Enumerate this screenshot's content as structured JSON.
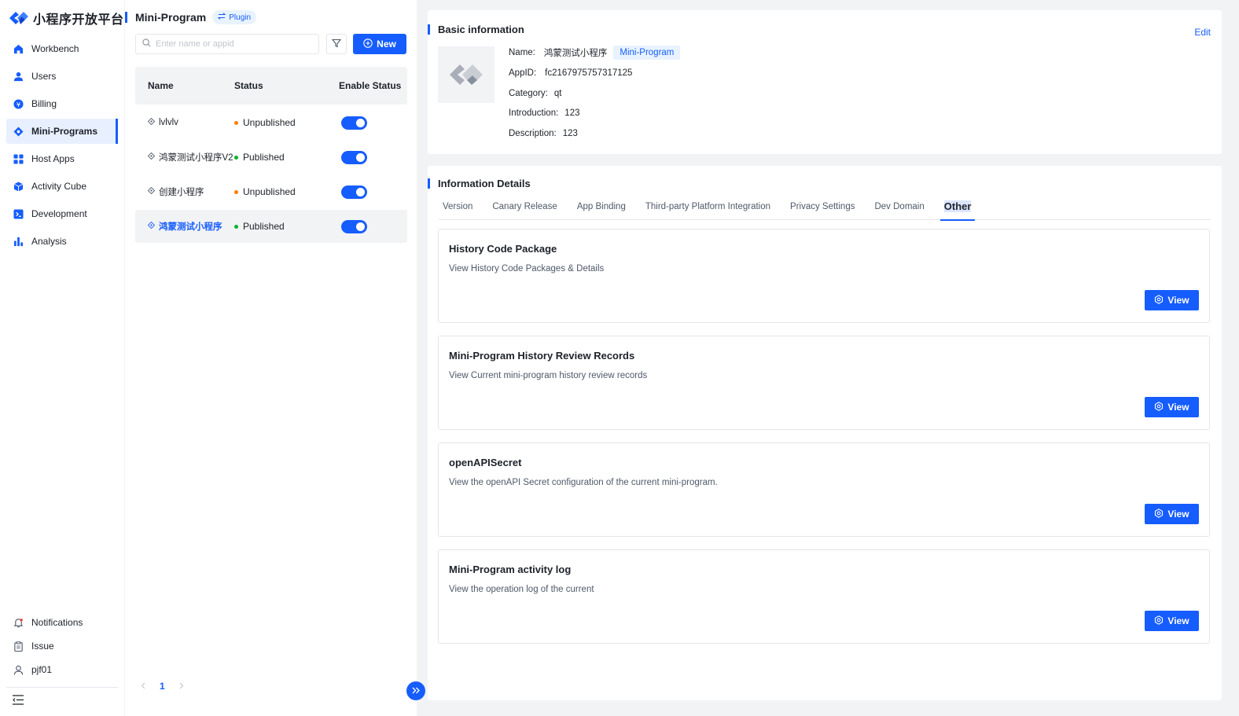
{
  "brand": {
    "name": "小程序开放平台"
  },
  "sidebar": {
    "items": [
      {
        "label": "Workbench",
        "icon": "home-icon"
      },
      {
        "label": "Users",
        "icon": "user-icon"
      },
      {
        "label": "Billing",
        "icon": "billing-icon"
      },
      {
        "label": "Mini-Programs",
        "icon": "mini-program-icon",
        "active": true
      },
      {
        "label": "Host Apps",
        "icon": "grid-icon"
      },
      {
        "label": "Activity Cube",
        "icon": "cube-icon"
      },
      {
        "label": "Development",
        "icon": "terminal-icon"
      },
      {
        "label": "Analysis",
        "icon": "bar-chart-icon"
      }
    ],
    "bottom": [
      {
        "label": "Notifications",
        "icon": "bell-icon"
      },
      {
        "label": "Issue",
        "icon": "clipboard-icon"
      },
      {
        "label": "pjf01",
        "icon": "user-outline-icon"
      }
    ]
  },
  "list_panel": {
    "title": "Mini-Program",
    "plugin_label": "Plugin",
    "search_placeholder": "Enter name or appid",
    "new_label": "New",
    "columns": {
      "name": "Name",
      "status": "Status",
      "enable": "Enable Status"
    },
    "rows": [
      {
        "name": "lvlvlv",
        "status": "Unpublished",
        "enabled": true
      },
      {
        "name": "鸿蒙测试小程序V2",
        "status": "Published",
        "enabled": true
      },
      {
        "name": "创建小程序",
        "status": "Unpublished",
        "enabled": true
      },
      {
        "name": "鸿蒙测试小程序",
        "status": "Published",
        "enabled": true,
        "selected": true
      }
    ],
    "pagination": {
      "current_page": "1"
    }
  },
  "basic_info": {
    "title": "Basic information",
    "edit_label": "Edit",
    "name_label": "Name:",
    "name_value": "鸿蒙测试小程序",
    "type_tag": "Mini-Program",
    "appid_label": "AppID:",
    "appid_value": "fc2167975757317125",
    "category_label": "Category:",
    "category_value": "qt",
    "introduction_label": "Introduction:",
    "introduction_value": "123",
    "description_label": "Description:",
    "description_value": "123"
  },
  "details": {
    "title": "Information Details",
    "tabs": [
      "Version",
      "Canary Release",
      "App Binding",
      "Third-party Platform Integration",
      "Privacy Settings",
      "Dev Domain",
      "Other"
    ],
    "active_tab": "Other",
    "cards": [
      {
        "title": "History Code Package",
        "desc": "View History Code Packages & Details",
        "button": "View"
      },
      {
        "title": "Mini-Program History Review Records",
        "desc": "View Current mini-program history review records",
        "button": "View"
      },
      {
        "title": "openAPISecret",
        "desc": "View the openAPI Secret configuration of the current mini-program.",
        "button": "View"
      },
      {
        "title": "Mini-Program activity log",
        "desc": "View the operation log of the current",
        "button": "View"
      }
    ]
  },
  "colors": {
    "primary": "#165dff",
    "published": "#00b42a",
    "unpublished": "#ff7d00",
    "background": "#f2f3f5"
  }
}
